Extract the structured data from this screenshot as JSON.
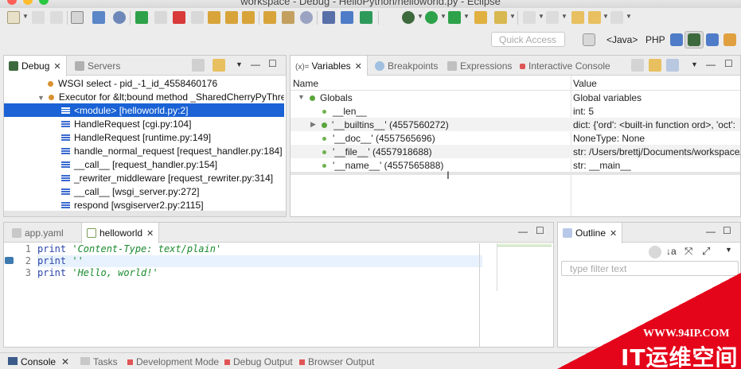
{
  "window": {
    "title": "workspace - Debug - HelloPython/helloworld.py - Eclipse"
  },
  "toolbar": {
    "quick_access_placeholder": "Quick Access",
    "perspectives": [
      "<Java>",
      "PHP"
    ]
  },
  "debug_view": {
    "tabs": [
      {
        "label": "Debug",
        "icon": "debug-bug-icon"
      },
      {
        "label": "Servers",
        "icon": "servers-icon"
      }
    ],
    "tree": [
      {
        "label": "WSGI select - pid_-1_id_4558460176",
        "kind": "process"
      },
      {
        "label": "Executor for &lt;bound method _SharedCherryPyThreadPool",
        "kind": "thread"
      },
      {
        "label": "<module> [helloworld.py:2]",
        "kind": "frame",
        "selected": true
      },
      {
        "label": "HandleRequest [cgi.py:104]",
        "kind": "frame"
      },
      {
        "label": "HandleRequest [runtime.py:149]",
        "kind": "frame"
      },
      {
        "label": "handle_normal_request [request_handler.py:184]",
        "kind": "frame"
      },
      {
        "label": "__call__ [request_handler.py:154]",
        "kind": "frame"
      },
      {
        "label": "_rewriter_middleware [request_rewriter.py:314]",
        "kind": "frame"
      },
      {
        "label": "__call__ [wsgi_server.py:272]",
        "kind": "frame"
      },
      {
        "label": "respond [wsgiserver2.py:2115]",
        "kind": "frame"
      }
    ]
  },
  "variables_view": {
    "tabs": [
      {
        "label": "Variables",
        "icon": "variables-icon"
      },
      {
        "label": "Breakpoints",
        "icon": "breakpoints-icon"
      },
      {
        "label": "Expressions",
        "icon": "expressions-icon"
      },
      {
        "label": "Interactive Console",
        "icon": "console-icon"
      }
    ],
    "columns": {
      "name": "Name",
      "value": "Value"
    },
    "rows": [
      {
        "name": "Globals",
        "value": "Global variables"
      },
      {
        "name": "__len__",
        "value": "int: 5"
      },
      {
        "name": "'__builtins__' (4557560272)",
        "value": "dict: {'ord': <built-in function ord>, 'oct':"
      },
      {
        "name": "'__doc__' (4557565696)",
        "value": "NoneType: None"
      },
      {
        "name": "'__file__' (4557918688)",
        "value": "str: /Users/brettj/Documents/workspace/"
      },
      {
        "name": "'__name__' (4557565888)",
        "value": "str: __main__"
      }
    ]
  },
  "editor": {
    "tabs": [
      {
        "label": "app.yaml",
        "icon": "yaml-file-icon"
      },
      {
        "label": "helloworld",
        "icon": "python-file-icon"
      }
    ],
    "lines": [
      {
        "n": "1",
        "kw": "print",
        "str": "'Content-Type: text/plain'"
      },
      {
        "n": "2",
        "kw": "print",
        "str": "''"
      },
      {
        "n": "3",
        "kw": "print",
        "str": "'Hello, world!'"
      }
    ]
  },
  "outline": {
    "tab": "Outline",
    "filter_placeholder": "type filter text"
  },
  "console_bar": {
    "tabs": [
      "Console",
      "Tasks",
      "Development Mode",
      "Debug Output",
      "Browser Output"
    ]
  },
  "watermark": {
    "url": "WWW.94IP.COM",
    "title": "IT运维空间"
  },
  "colors": {
    "selection": "#1a62d5",
    "keyword": "#2a46a8",
    "string": "#1a8a2e",
    "watermark": "#e5051b"
  }
}
